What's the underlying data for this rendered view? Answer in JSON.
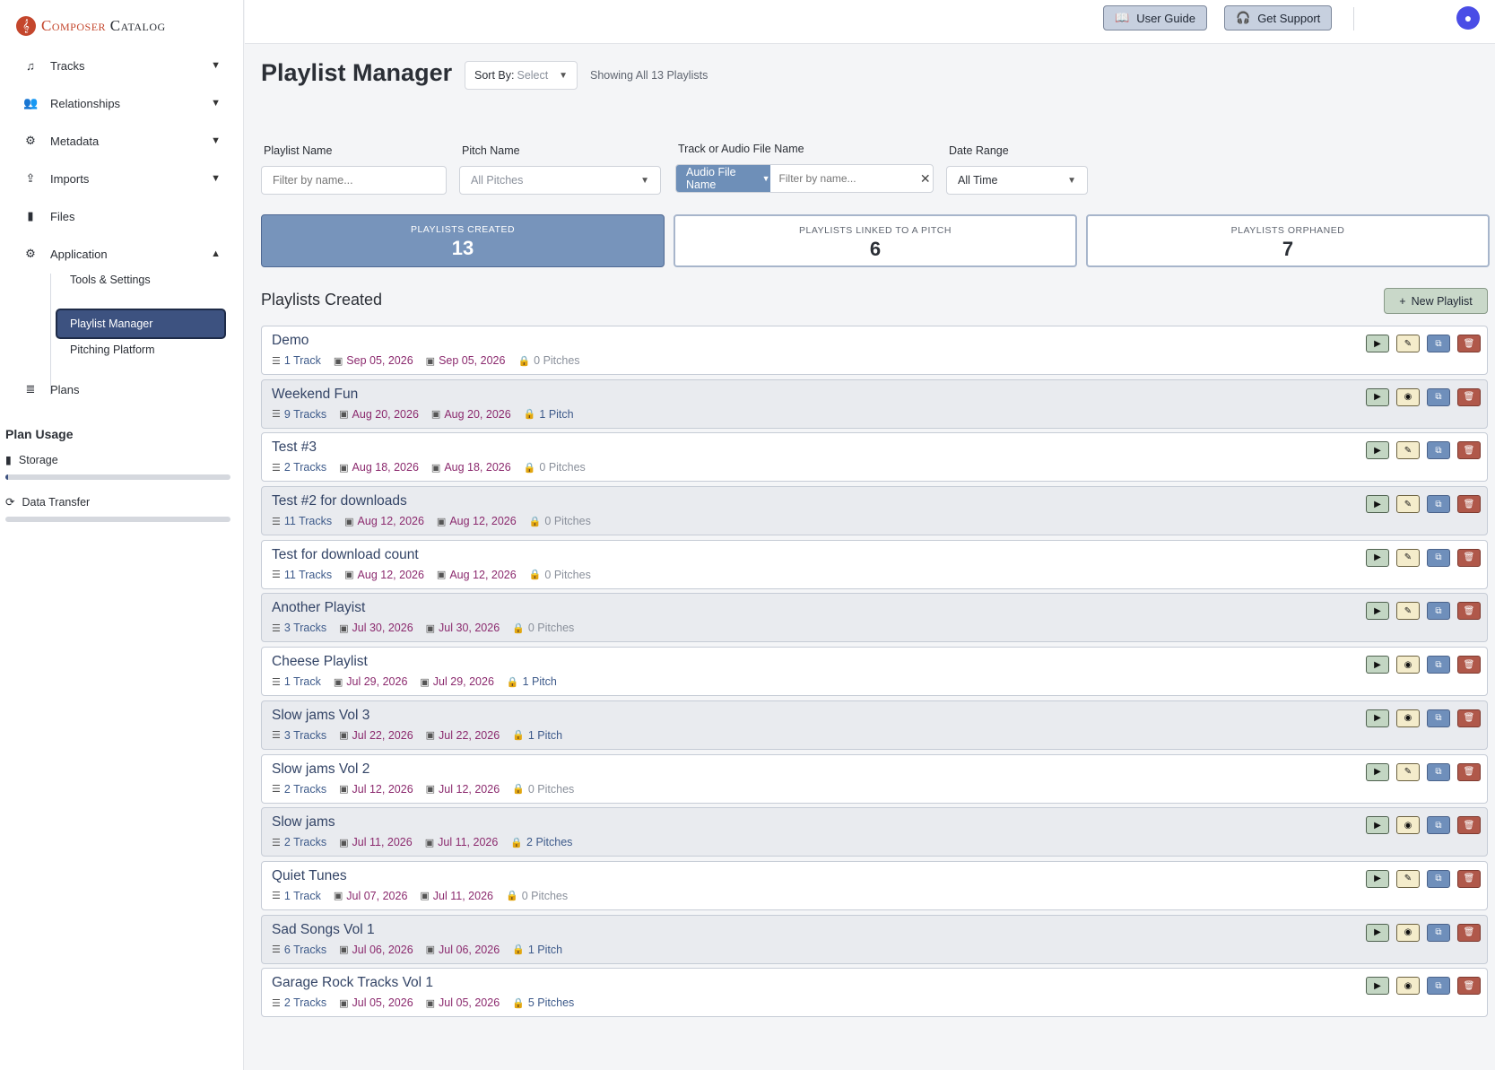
{
  "brand": {
    "name_first": "Composer",
    "name_second": "Catalog"
  },
  "topbar": {
    "user_guide": "User Guide",
    "get_support": "Get Support"
  },
  "sidebar": {
    "items": [
      {
        "label": "Tracks",
        "icon": "music-note-icon"
      },
      {
        "label": "Relationships",
        "icon": "users-icon"
      },
      {
        "label": "Metadata",
        "icon": "gears-icon"
      },
      {
        "label": "Imports",
        "icon": "upload-icon"
      },
      {
        "label": "Files",
        "icon": "file-icon"
      },
      {
        "label": "Application",
        "icon": "gears-icon"
      },
      {
        "label": "Plans",
        "icon": "database-icon"
      }
    ],
    "sub_items": [
      "Tools & Settings",
      "Playlist Manager",
      "Pitching Platform"
    ],
    "active_sub": "Playlist Manager",
    "plan_usage": {
      "title": "Plan Usage",
      "storage": "Storage",
      "storage_fill": 0.01,
      "transfer": "Data Transfer",
      "transfer_fill": 0
    }
  },
  "page": {
    "title": "Playlist Manager",
    "sort_label": "Sort By",
    "sort_value": "Select",
    "showing": "Showing All 13 Playlists"
  },
  "filters": {
    "playlist_label": "Playlist Name",
    "playlist_placeholder": "Filter by name...",
    "pitch_label": "Pitch Name",
    "pitch_value": "All Pitches",
    "track_label": "Track or Audio File Name",
    "track_mode": "Audio File Name",
    "track_placeholder": "Filter by name...",
    "date_label": "Date Range",
    "date_value": "All Time"
  },
  "stats": {
    "created_label": "PLAYLISTS CREATED",
    "created_value": "13",
    "linked_label": "PLAYLISTS LINKED TO A PITCH",
    "linked_value": "6",
    "orphaned_label": "PLAYLISTS ORPHANED",
    "orphaned_value": "7"
  },
  "list": {
    "title": "Playlists Created",
    "new_button": "New Playlist",
    "rows": [
      {
        "name": "Demo",
        "tracks": "1 Track",
        "created": "Sep 05, 2026",
        "updated": "Sep 05, 2026",
        "pitches": "0 Pitches",
        "linked": false
      },
      {
        "name": "Weekend Fun",
        "tracks": "9 Tracks",
        "created": "Aug 20, 2026",
        "updated": "Aug 20, 2026",
        "pitches": "1 Pitch",
        "linked": true
      },
      {
        "name": "Test #3",
        "tracks": "2 Tracks",
        "created": "Aug 18, 2026",
        "updated": "Aug 18, 2026",
        "pitches": "0 Pitches",
        "linked": false
      },
      {
        "name": "Test #2 for downloads",
        "tracks": "11 Tracks",
        "created": "Aug 12, 2026",
        "updated": "Aug 12, 2026",
        "pitches": "0 Pitches",
        "linked": false
      },
      {
        "name": "Test for download count",
        "tracks": "11 Tracks",
        "created": "Aug 12, 2026",
        "updated": "Aug 12, 2026",
        "pitches": "0 Pitches",
        "linked": false
      },
      {
        "name": "Another Playist",
        "tracks": "3 Tracks",
        "created": "Jul 30, 2026",
        "updated": "Jul 30, 2026",
        "pitches": "0 Pitches",
        "linked": false
      },
      {
        "name": "Cheese Playlist",
        "tracks": "1 Track",
        "created": "Jul 29, 2026",
        "updated": "Jul 29, 2026",
        "pitches": "1 Pitch",
        "linked": true
      },
      {
        "name": "Slow jams Vol 3",
        "tracks": "3 Tracks",
        "created": "Jul 22, 2026",
        "updated": "Jul 22, 2026",
        "pitches": "1 Pitch",
        "linked": true
      },
      {
        "name": "Slow jams Vol 2",
        "tracks": "2 Tracks",
        "created": "Jul 12, 2026",
        "updated": "Jul 12, 2026",
        "pitches": "0 Pitches",
        "linked": false
      },
      {
        "name": "Slow jams",
        "tracks": "2 Tracks",
        "created": "Jul 11, 2026",
        "updated": "Jul 11, 2026",
        "pitches": "2 Pitches",
        "linked": true
      },
      {
        "name": "Quiet Tunes",
        "tracks": "1 Track",
        "created": "Jul 07, 2026",
        "updated": "Jul 11, 2026",
        "pitches": "0 Pitches",
        "linked": false
      },
      {
        "name": "Sad Songs Vol 1",
        "tracks": "6 Tracks",
        "created": "Jul 06, 2026",
        "updated": "Jul 06, 2026",
        "pitches": "1 Pitch",
        "linked": true
      },
      {
        "name": "Garage Rock Tracks Vol 1",
        "tracks": "2 Tracks",
        "created": "Jul 05, 2026",
        "updated": "Jul 05, 2026",
        "pitches": "5 Pitches",
        "linked": true
      }
    ]
  },
  "colors": {
    "primary": "#3d5280",
    "accent": "#7794bb",
    "date": "#8b2a6e",
    "delete": "#b0584a"
  }
}
